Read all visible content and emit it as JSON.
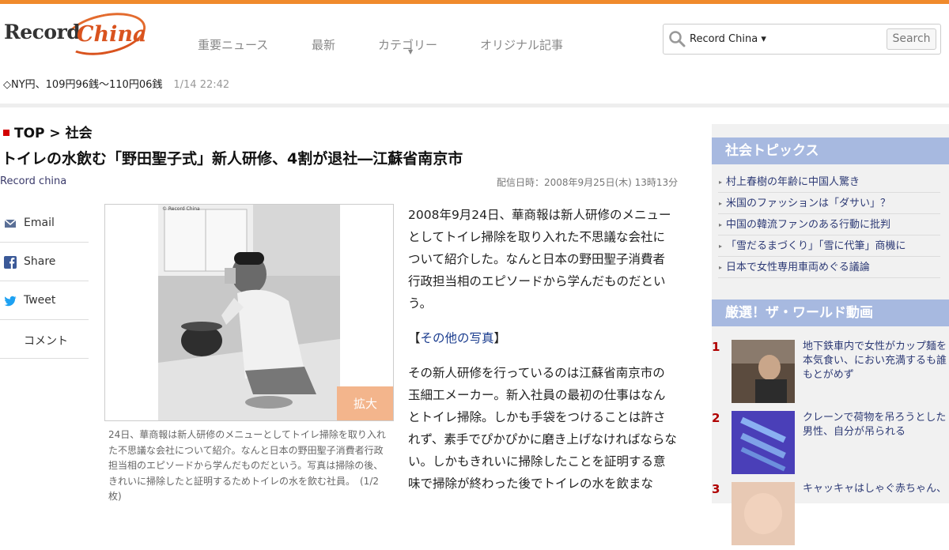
{
  "brand": {
    "logo_record": "Record",
    "logo_china": "China",
    "accent": "#f08a2c"
  },
  "nav": {
    "items": [
      {
        "label": "重要ニュース"
      },
      {
        "label": "最新"
      },
      {
        "label": "カテゴリー"
      },
      {
        "label": "オリジナル記事"
      }
    ]
  },
  "search": {
    "scope": "Record China ▾",
    "button": "Search",
    "icon": "search-icon"
  },
  "ticker": {
    "text": "◇NY円、109円96銭～110円06銭",
    "time": "1/14 22:42"
  },
  "breadcrumb": {
    "top": "TOP",
    "sep": " > ",
    "section": "社会"
  },
  "article": {
    "title": "トイレの水飲む「野田聖子式」新人研修、4割が退社―江蘇省南京市",
    "source": "Record china",
    "date": "配信日時：2008年9月25日(木) 13時13分",
    "photo_credit": "© Record China",
    "enlarge": "拡大",
    "caption": "24日、華商報は新人研修のメニューとしてトイレ掃除を取り入れた不思議な会社について紹介。なんと日本の野田聖子消費者行政担当相のエピソードから学んだものだという。写真は掃除の後、きれいに掃除したと証明するためトイレの水を飲む社員。　(1/2枚)",
    "p1": "2008年9月24日、華商報は新人研修のメニューとしてトイレ掃除を取り入れた不思議な会社について紹介した。なんと日本の野田聖子消費者行政担当相のエピソードから学んだものだという。",
    "photos_open": "【",
    "photos_link": "その他の写真",
    "photos_close": "】",
    "p2": "その新人研修を行っているのは江蘇省南京市の玉細工メーカー。新入社員の最初の仕事はなんとトイレ掃除。しかも手袋をつけることは許されず、素手でぴかぴかに磨き上げなければならない。しかもきれいに掃除したことを証明する意味で掃除が終わった後でトイレの水を飲まな"
  },
  "share": [
    {
      "label": "Email",
      "icon": "email-icon"
    },
    {
      "label": "Share",
      "icon": "facebook-icon"
    },
    {
      "label": "Tweet",
      "icon": "twitter-icon"
    },
    {
      "label": "コメント",
      "icon": ""
    }
  ],
  "sidebar": {
    "topics_title": "社会トピックス",
    "topics": [
      "村上春樹の年齢に中国人驚き",
      "米国のファッションは「ダサい」？",
      "中国の韓流ファンのある行動に批判",
      "「雪だるまづくり」「雪に代筆」商機に",
      "日本で女性専用車両めぐる議論"
    ],
    "video_title": "厳選！ザ・ワールド動画",
    "videos": [
      {
        "rank": "1",
        "text": "地下鉄車内で女性がカップ麺を本気食い、におい充満するも誰もとがめず"
      },
      {
        "rank": "2",
        "text": "クレーンで荷物を吊ろうとした男性、自分が吊られる"
      },
      {
        "rank": "3",
        "text": "キャッキャはしゃぐ赤ちゃん、"
      }
    ]
  }
}
